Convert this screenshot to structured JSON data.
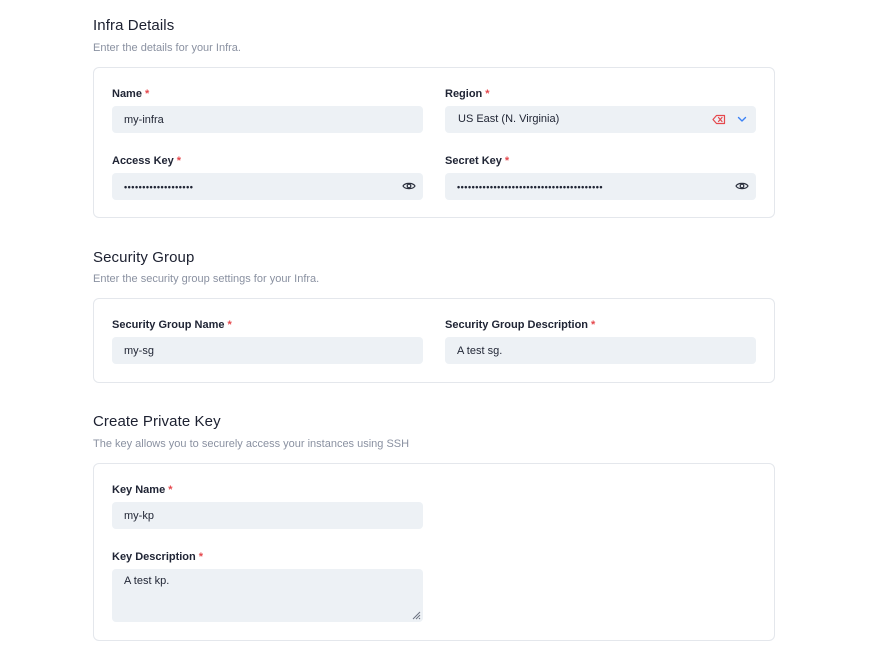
{
  "infra": {
    "title": "Infra Details",
    "subtitle": "Enter the details for your Infra.",
    "name": {
      "label": "Name",
      "value": "my-infra"
    },
    "region": {
      "label": "Region",
      "value": "US East (N. Virginia)"
    },
    "access_key": {
      "label": "Access Key",
      "value": "•••••••••••••••••••"
    },
    "secret_key": {
      "label": "Secret Key",
      "value": "••••••••••••••••••••••••••••••••••••••••"
    }
  },
  "security_group": {
    "title": "Security Group",
    "subtitle": "Enter the security group settings for your Infra.",
    "name": {
      "label": "Security Group Name",
      "value": "my-sg"
    },
    "description": {
      "label": "Security Group Description",
      "value": "A test sg."
    }
  },
  "private_key": {
    "title": "Create Private Key",
    "subtitle": "The key allows you to securely access your instances using SSH",
    "name": {
      "label": "Key Name",
      "value": "my-kp"
    },
    "description": {
      "label": "Key Description",
      "value": "A test kp."
    }
  },
  "required_marker": "*",
  "colors": {
    "accent": "#3b82f6",
    "required": "#e5484d",
    "clear": "#e5484d",
    "input_bg": "#edf1f5"
  },
  "icons": {
    "clear": "backspace-x-icon",
    "chevron": "chevron-down-icon",
    "reveal": "eye-icon"
  }
}
